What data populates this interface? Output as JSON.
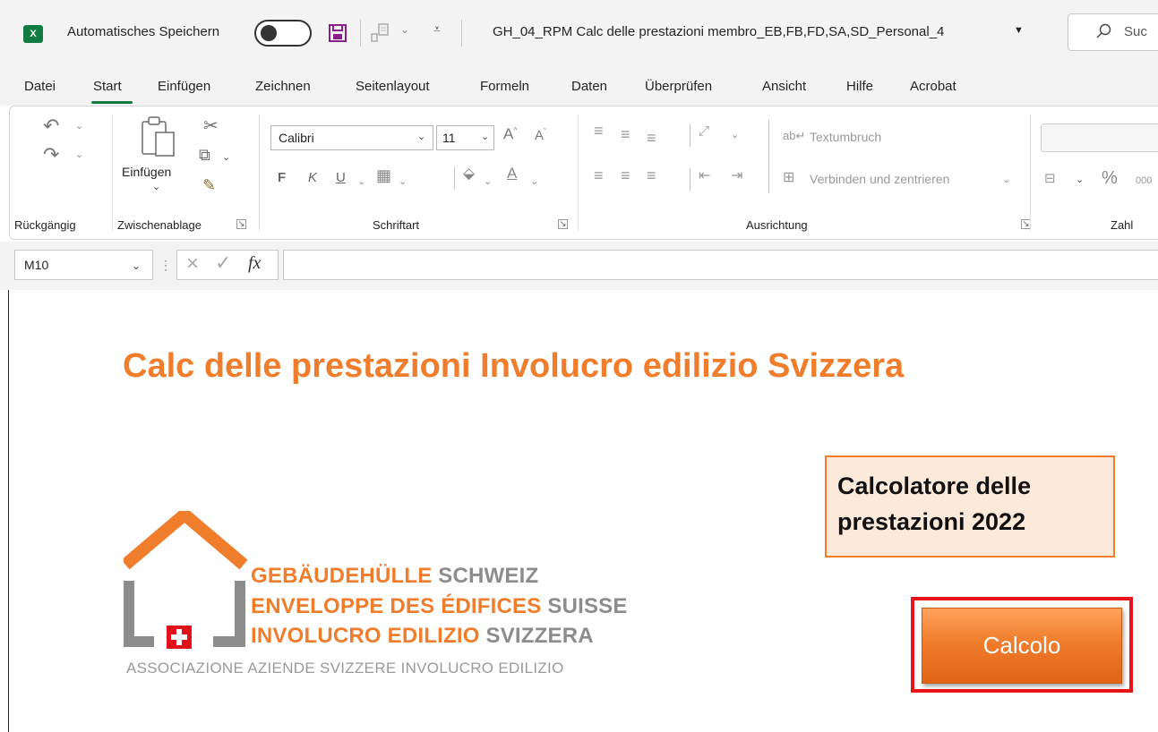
{
  "titlebar": {
    "app_icon": "excel-icon",
    "app_icon_letter": "X",
    "autosave_label": "Automatisches Speichern",
    "document_title": "GH_04_RPM Calc delle prestazioni membro_EB,FB,FD,SA,SD_Personal_4",
    "search_placeholder": "Suc"
  },
  "tabs": [
    "Datei",
    "Start",
    "Einfügen",
    "Zeichnen",
    "Seitenlayout",
    "Formeln",
    "Daten",
    "Überprüfen",
    "Ansicht",
    "Hilfe",
    "Acrobat"
  ],
  "active_tab": "Start",
  "ribbon": {
    "undo_group": "Rückgängig",
    "clipboard_group": "Zwischenablage",
    "paste_label": "Einfügen",
    "font_group": "Schriftart",
    "font_name": "Calibri",
    "font_size": "11",
    "bold": "F",
    "italic": "K",
    "underline": "U",
    "alignment_group": "Ausrichtung",
    "wrap_text": "Textumbruch",
    "merge_center": "Verbinden und zentrieren",
    "number_group": "Zahl",
    "percent": "%",
    "thousands": "000"
  },
  "formula_bar": {
    "name_box": "M10",
    "formula": ""
  },
  "sheet": {
    "title": "Calc delle prestazioni Involucro edilizio Svizzera",
    "calc_box_text": "Calcolatore delle\nprestazioni 2022",
    "calc_button": "Calcolo",
    "logo": {
      "line1_orange": "GEBÄUDEHÜLLE",
      "line1_gray": "SCHWEIZ",
      "line2_orange": "ENVELOPPE DES ÉDIFICES",
      "line2_gray": "SUISSE",
      "line3_orange": "INVOLUCRO EDILIZIO",
      "line3_gray": "SVIZZERA",
      "subtitle": "ASSOCIAZIONE AZIENDE SVIZZERE INVOLUCRO EDILIZIO"
    }
  },
  "colors": {
    "excel_green": "#107c41",
    "brand_orange": "#f07d2c",
    "logo_gray": "#8c8c8c",
    "highlight_red": "#e8141a",
    "box_fill": "#fce9d9"
  }
}
